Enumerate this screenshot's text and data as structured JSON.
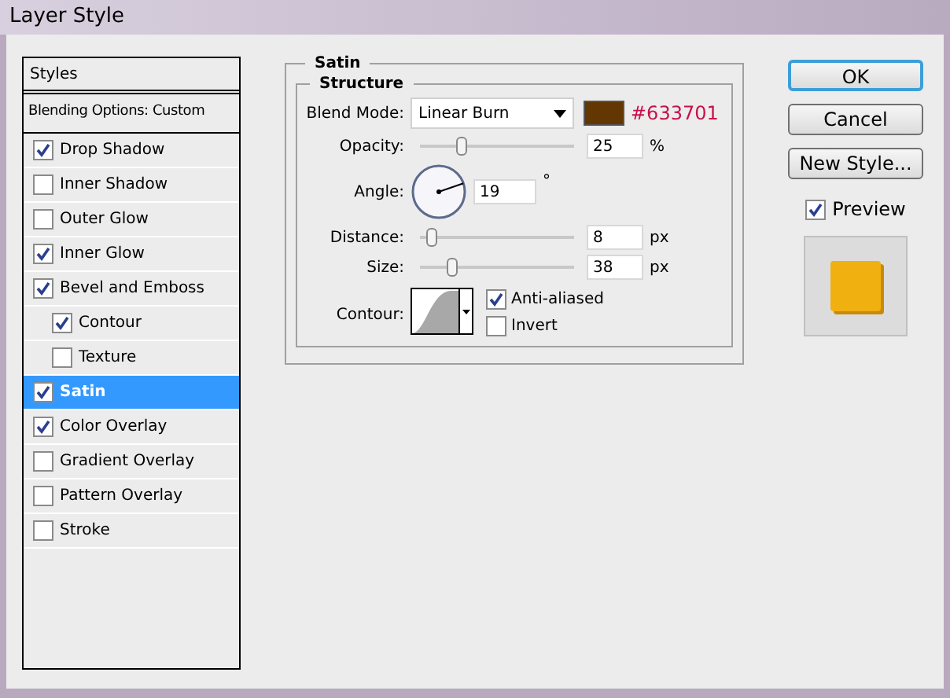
{
  "window": {
    "title": "Layer Style"
  },
  "styles_list": {
    "header": "Styles",
    "blending": "Blending Options: Custom",
    "items": [
      {
        "label": "Drop Shadow",
        "checked": true,
        "selected": false,
        "indented": false
      },
      {
        "label": "Inner Shadow",
        "checked": false,
        "selected": false,
        "indented": false
      },
      {
        "label": "Outer Glow",
        "checked": false,
        "selected": false,
        "indented": false
      },
      {
        "label": "Inner Glow",
        "checked": true,
        "selected": false,
        "indented": false
      },
      {
        "label": "Bevel and Emboss",
        "checked": true,
        "selected": false,
        "indented": false
      },
      {
        "label": "Contour",
        "checked": true,
        "selected": false,
        "indented": true
      },
      {
        "label": "Texture",
        "checked": false,
        "selected": false,
        "indented": true
      },
      {
        "label": "Satin",
        "checked": true,
        "selected": true,
        "indented": false
      },
      {
        "label": "Color Overlay",
        "checked": true,
        "selected": false,
        "indented": false
      },
      {
        "label": "Gradient Overlay",
        "checked": false,
        "selected": false,
        "indented": false
      },
      {
        "label": "Pattern Overlay",
        "checked": false,
        "selected": false,
        "indented": false
      },
      {
        "label": "Stroke",
        "checked": false,
        "selected": false,
        "indented": false
      }
    ]
  },
  "panel": {
    "title": "Satin",
    "group": "Structure",
    "blend_mode": {
      "label": "Blend Mode:",
      "value": "Linear Burn",
      "color_code": "#633701"
    },
    "opacity": {
      "label": "Opacity:",
      "level": 0.25,
      "value": "25",
      "unit": "%"
    },
    "angle": {
      "label": "Angle:",
      "value": "19",
      "unit": "°"
    },
    "distance": {
      "label": "Distance:",
      "level": 0.04,
      "value": "8",
      "unit": "px"
    },
    "size": {
      "label": "Size:",
      "level": 0.19,
      "value": "38",
      "unit": "px"
    },
    "contour": {
      "label": "Contour:"
    },
    "options": [
      {
        "label": "Anti-aliased",
        "checked": true
      },
      {
        "label": "Invert",
        "checked": false
      }
    ]
  },
  "buttons": [
    {
      "label": "OK",
      "default": true
    },
    {
      "label": "Cancel",
      "default": false
    },
    {
      "label": "New Style...",
      "default": false
    }
  ],
  "preview": {
    "label": "Preview",
    "checked": true
  }
}
